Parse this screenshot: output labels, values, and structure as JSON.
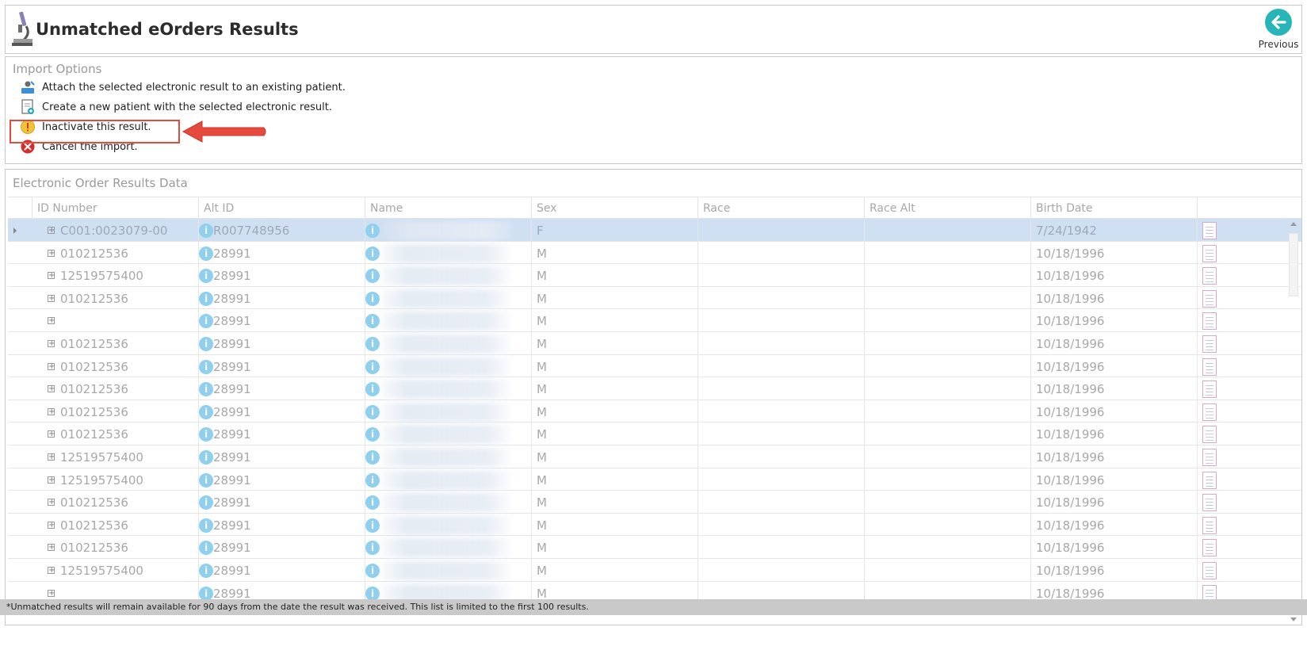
{
  "header": {
    "title": "Unmatched eOrders Results",
    "previous_label": "Previous"
  },
  "import_options": {
    "title": "Import Options",
    "options": [
      {
        "label": "Attach the selected electronic result to an existing patient.",
        "icon": "attach-patient-icon"
      },
      {
        "label": "Create a new patient with the selected electronic result.",
        "icon": "new-patient-icon"
      },
      {
        "label": "Inactivate this result.",
        "icon": "warning-icon"
      },
      {
        "label": "Cancel the import.",
        "icon": "cancel-icon"
      }
    ]
  },
  "data_section": {
    "title": "Electronic Order Results Data",
    "columns": [
      "ID Number",
      "Alt ID",
      "Name",
      "Sex",
      "Race",
      "Race Alt",
      "Birth Date"
    ],
    "rows": [
      {
        "id": "C001:0023079-00",
        "alt_id": "R007748956",
        "sex": "F",
        "race": "",
        "race_alt": "",
        "birth_date": "7/24/1942",
        "selected": true
      },
      {
        "id": "010212536",
        "alt_id": "28991",
        "sex": "M",
        "race": "",
        "race_alt": "",
        "birth_date": "10/18/1996"
      },
      {
        "id": "12519575400",
        "alt_id": "28991",
        "sex": "M",
        "race": "",
        "race_alt": "",
        "birth_date": "10/18/1996"
      },
      {
        "id": "010212536",
        "alt_id": "28991",
        "sex": "M",
        "race": "",
        "race_alt": "",
        "birth_date": "10/18/1996"
      },
      {
        "id": "",
        "alt_id": "28991",
        "sex": "M",
        "race": "",
        "race_alt": "",
        "birth_date": "10/18/1996"
      },
      {
        "id": "010212536",
        "alt_id": "28991",
        "sex": "M",
        "race": "",
        "race_alt": "",
        "birth_date": "10/18/1996"
      },
      {
        "id": "010212536",
        "alt_id": "28991",
        "sex": "M",
        "race": "",
        "race_alt": "",
        "birth_date": "10/18/1996"
      },
      {
        "id": "010212536",
        "alt_id": "28991",
        "sex": "M",
        "race": "",
        "race_alt": "",
        "birth_date": "10/18/1996"
      },
      {
        "id": "010212536",
        "alt_id": "28991",
        "sex": "M",
        "race": "",
        "race_alt": "",
        "birth_date": "10/18/1996"
      },
      {
        "id": "010212536",
        "alt_id": "28991",
        "sex": "M",
        "race": "",
        "race_alt": "",
        "birth_date": "10/18/1996"
      },
      {
        "id": "12519575400",
        "alt_id": "28991",
        "sex": "M",
        "race": "",
        "race_alt": "",
        "birth_date": "10/18/1996"
      },
      {
        "id": "12519575400",
        "alt_id": "28991",
        "sex": "M",
        "race": "",
        "race_alt": "",
        "birth_date": "10/18/1996"
      },
      {
        "id": "010212536",
        "alt_id": "28991",
        "sex": "M",
        "race": "",
        "race_alt": "",
        "birth_date": "10/18/1996"
      },
      {
        "id": "010212536",
        "alt_id": "28991",
        "sex": "M",
        "race": "",
        "race_alt": "",
        "birth_date": "10/18/1996"
      },
      {
        "id": "010212536",
        "alt_id": "28991",
        "sex": "M",
        "race": "",
        "race_alt": "",
        "birth_date": "10/18/1996"
      },
      {
        "id": "12519575400",
        "alt_id": "28991",
        "sex": "M",
        "race": "",
        "race_alt": "",
        "birth_date": "10/18/1996"
      },
      {
        "id": "",
        "alt_id": "28991",
        "sex": "M",
        "race": "",
        "race_alt": "",
        "birth_date": "10/18/1996"
      }
    ]
  },
  "footer": {
    "note": "*Unmatched results will remain available for 90 days from the date the result was received. This list is limited to the first 100 results."
  },
  "colors": {
    "accent": "#27b5b8",
    "highlight": "#e64a3c",
    "selected_row": "#cfe0f3"
  }
}
